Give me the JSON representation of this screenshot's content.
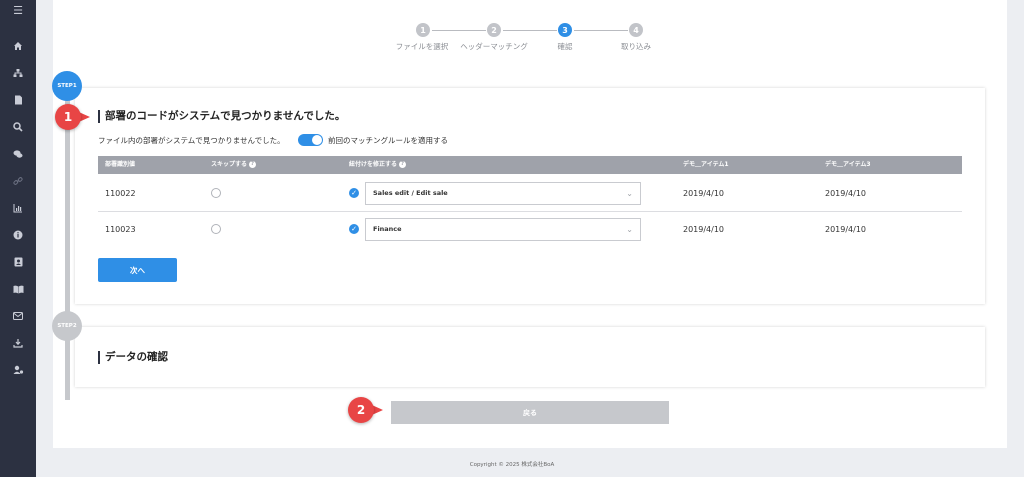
{
  "sidebar": {
    "icons": [
      "menu-icon",
      "home-icon",
      "org-chart-icon",
      "document-icon",
      "search-icon",
      "chat-icon",
      "link-icon",
      "chart-icon",
      "info-icon",
      "contacts-icon",
      "book-icon",
      "mail-icon",
      "download-icon",
      "user-settings-icon"
    ]
  },
  "stepper": {
    "steps": [
      {
        "num": "1",
        "label": "ファイルを選択"
      },
      {
        "num": "2",
        "label": "ヘッダーマッチング"
      },
      {
        "num": "3",
        "label": "確認"
      },
      {
        "num": "4",
        "label": "取り込み"
      }
    ],
    "active_step": 3
  },
  "timeline": {
    "step1": "STEP1",
    "step2": "STEP2"
  },
  "section1": {
    "title": "部署のコードがシステムで見つかりませんでした。",
    "note": "ファイル内の部署がシステムで見つかりませんでした。",
    "toggle_label": "前回のマッチングルールを適用する",
    "toggle_on": true,
    "columns": [
      "部署識別値",
      "スキップする",
      "紐付けを修正する",
      "デモ＿アイテム1",
      "デモ＿アイテム3"
    ],
    "rows": [
      {
        "code": "110022",
        "skip": false,
        "fix": true,
        "select_value": "Sales edit / Edit sale",
        "item1": "2019/4/10",
        "item3": "2019/4/10"
      },
      {
        "code": "110023",
        "skip": false,
        "fix": true,
        "select_value": "Finance",
        "item1": "2019/4/10",
        "item3": "2019/4/10"
      }
    ],
    "next_button": "次へ"
  },
  "section2": {
    "title": "データの確認"
  },
  "back_button": "戻る",
  "markers": {
    "m1": "1",
    "m2": "2"
  },
  "footer": "Copyright © 2025 株式会社BoA",
  "colors": {
    "accent": "#2f8fe6",
    "sidebar": "#2c3141",
    "marker": "#e84545",
    "disabled": "#c6c8cc"
  }
}
